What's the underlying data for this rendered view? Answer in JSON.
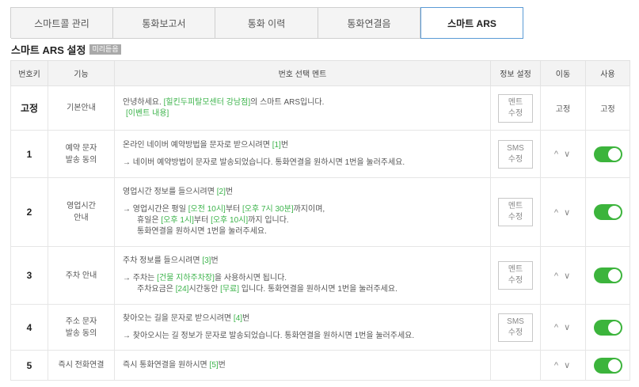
{
  "tabs": [
    {
      "label": "스마트콜 관리"
    },
    {
      "label": "통화보고서"
    },
    {
      "label": "통화 이력"
    },
    {
      "label": "통화연결음"
    },
    {
      "label": "스마트 ARS"
    }
  ],
  "section": {
    "title": "스마트 ARS 설정",
    "badge": "미리듣음"
  },
  "table": {
    "headers": {
      "key": "번호키",
      "function": "기능",
      "ment": "번호 선택 멘트",
      "info": "정보 설정",
      "move": "이동",
      "use": "사용"
    },
    "rows": [
      {
        "key": "고정",
        "function": "기본안내",
        "ment_line1_a": "안녕하세요. ",
        "ment_line1_b": "[힐킨두피탈모센터 강남점]",
        "ment_line1_c": "의 스마트 ARS입니다.",
        "ment_line2": "[이벤트 내용]",
        "button": "멘트\n수정",
        "move": "고정",
        "use": "고정"
      },
      {
        "key": "1",
        "function": "예약 문자\n발송 동의",
        "ment_a": "온라인 네이버 예약방법을 문자로 받으시려면 ",
        "ment_b": "[1]",
        "ment_c": "번",
        "arrow": "→ 네이버 예약방법이 문자로 발송되었습니다. 통화연결을 원하시면 1번을 눌러주세요.",
        "button": "SMS\n수정",
        "move": "^ ∨",
        "use_on": true
      },
      {
        "key": "2",
        "function": "영업시간\n안내",
        "ment_a": "영업시간 정보를 들으시려면 ",
        "ment_b": "[2]",
        "ment_c": "번",
        "arrow_a": "→ 영업시간은 평일  ",
        "arrow_b": "[오전 10시]",
        "arrow_c": "부터 ",
        "arrow_d": "[오후 7시 30분]",
        "arrow_e": "까지이며,",
        "sub1_a": "휴일은 ",
        "sub1_b": "[오후 1시]",
        "sub1_c": "부터 ",
        "sub1_d": "[오후 10시]",
        "sub1_e": "까지 입니다.",
        "sub2": "통화연결을 원하시면 1번을 눌러주세요.",
        "button": "멘트\n수정",
        "move": "^ ∨",
        "use_on": true
      },
      {
        "key": "3",
        "function": "주차 안내",
        "ment_a": "주차 정보를 들으시려면 ",
        "ment_b": "[3]",
        "ment_c": "번",
        "arrow_a": "→ 주차는 ",
        "arrow_b": "[건물 지하주차장]",
        "arrow_c": "을 사용하시면 됩니다.",
        "sub1_a": "주차요금은 ",
        "sub1_b": "[24]",
        "sub1_c": "시간동안 ",
        "sub1_d": "[무료]",
        "sub1_e": " 입니다.  통화연결을 원하시면 1번을 눌러주세요.",
        "button": "멘트\n수정",
        "move": "^ ∨",
        "use_on": true
      },
      {
        "key": "4",
        "function": "주소 문자\n발송 동의",
        "ment_a": "찾아오는 길을 문자로 받으시려면 ",
        "ment_b": "[4]",
        "ment_c": "번",
        "arrow": "→ 찾아오시는 길 정보가 문자로 발송되었습니다. 통화연결을 원하시면 1번을 눌러주세요.",
        "button": "SMS\n수정",
        "move": "^ ∨",
        "use_on": true
      },
      {
        "key": "5",
        "function": "즉시 전화연결",
        "ment_a": "즉시 통화연결을 원하시면  ",
        "ment_b": "[5]",
        "ment_c": "번",
        "move": "^ ∨",
        "use_on": true
      }
    ]
  },
  "colors": {
    "accent_green": "#3bb34a",
    "toggle_on": "#3cb43c",
    "active_tab_border": "#5b9bd5"
  }
}
